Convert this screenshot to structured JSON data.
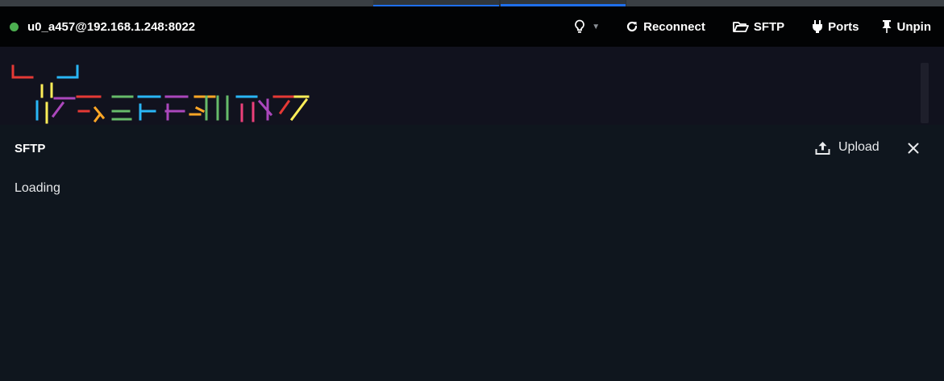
{
  "session": {
    "host_label": "u0_a457@192.168.1.248:8022",
    "status_color": "#4caf50",
    "status_icon": "status-dot"
  },
  "toolbar": {
    "theme_icon": "lightbulb-icon",
    "reconnect_label": "Reconnect",
    "sftp_label": "SFTP",
    "ports_label": "Ports",
    "unpin_label": "Unpin"
  },
  "terminal": {
    "banner_colors": [
      "#e53935",
      "#29b6f6",
      "#ffee58",
      "#ab47bc",
      "#66bb6a",
      "#ffa726",
      "#ec407a"
    ]
  },
  "sftp": {
    "title": "SFTP",
    "upload_label": "Upload",
    "status_text": "Loading"
  },
  "colors": {
    "accent": "#1f6feb",
    "titlebar_bg": "#020304",
    "panel_bg": "#0f161e",
    "terminal_bg": "#11121e"
  }
}
